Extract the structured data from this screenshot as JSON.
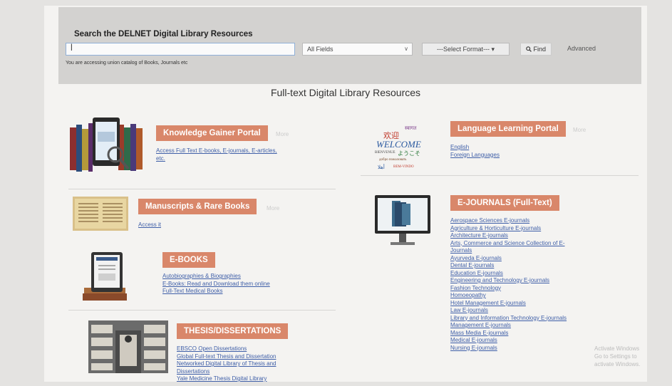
{
  "search": {
    "title": "Search the DELNET Digital Library Resources",
    "input_value": "|",
    "fields_value": "All Fields",
    "format_value": "---Select Format--- ▾",
    "find_label": "Find",
    "advanced_label": "Advanced",
    "notice": "You are accessing union catalog of Books, Journals etc"
  },
  "heading": "Full-text Digital Library Resources",
  "portals": {
    "knowledge": {
      "label": "Knowledge Gainer Portal",
      "links": [
        "Access Full Text E-books, E-journals, E-articles,",
        "etc."
      ]
    },
    "language": {
      "label": "Language Learning Portal",
      "links": [
        "English",
        "Foreign Languages"
      ],
      "banner": [
        "欢迎",
        "स्वागत",
        "WELCOME",
        "BIENVENUE",
        "ようこそ",
        "добро пожаловать",
        "أهلا",
        "BEM-VINDO"
      ]
    },
    "manuscripts": {
      "label": "Manuscripts & Rare Books",
      "links": [
        "Access it"
      ]
    },
    "ebooks": {
      "label": "E-BOOKS",
      "links": [
        "Autobiographies & Biographies",
        "E-Books: Read and Download them online",
        "Full-Text Medical Books"
      ]
    },
    "ejournals": {
      "label": "E-JOURNALS (Full-Text)",
      "links": [
        "Aerospace Sciences E-journals",
        "Agriculture & Horticulture E-journals",
        "Architecture E-journals",
        "Arts, Commerce and Science Collection of E-",
        "Journals",
        "Ayurveda E-journals",
        "Dental E-journals",
        "Education E-journals",
        "Engineering and Technology E-journals",
        "Fashion Technology",
        "Homoeopathy",
        "Hotel Management E-journals",
        "Law E-journals",
        "Library and Information Technology E-journals",
        "Management E-journals",
        "Mass Media E-journals",
        "Medical E-journals",
        "Nursing E-journals"
      ]
    },
    "thesis": {
      "label": "THESIS/DISSERTATIONS",
      "links": [
        "EBSCO Open Dissertations",
        "Global Full-text Thesis and Dissertation",
        "Networked Digital Library of Thesis and",
        "Dissertations",
        "Yale Medicine Thesis Digital Library"
      ]
    }
  },
  "watermark": [
    "Activate Windows",
    "Go to Settings to activate Windows."
  ]
}
